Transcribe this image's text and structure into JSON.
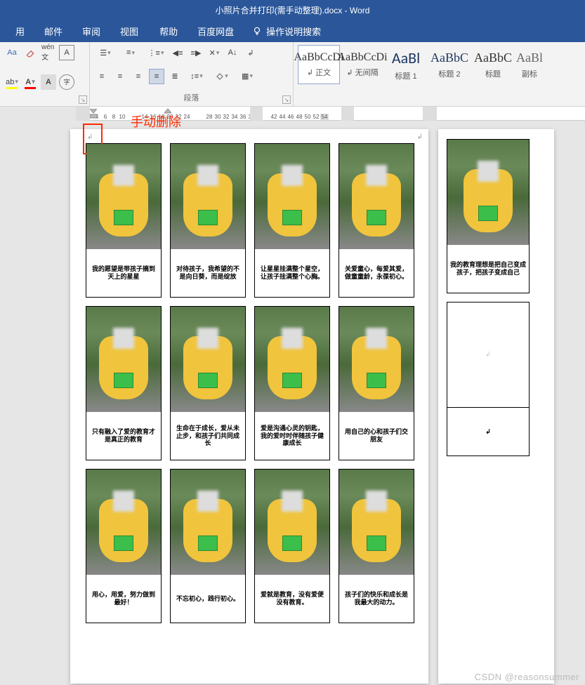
{
  "title_bar": {
    "text": "小照片合并打印(需手动整理).docx - Word"
  },
  "tabs": {
    "t0": "用",
    "t1": "邮件",
    "t2": "审阅",
    "t3": "视图",
    "t4": "帮助",
    "t5": "百度网盘",
    "tell_me": "操作说明搜索"
  },
  "font_group": {
    "label": "",
    "aa": "Aa",
    "wen": "wén文"
  },
  "para_group": {
    "label": "段落"
  },
  "styles": {
    "s0": {
      "preview": "AaBbCcDi",
      "label": "↲ 正文"
    },
    "s1": {
      "preview": "AaBbCcDi",
      "label": "↲ 无间隔"
    },
    "s2": {
      "preview": "AaBl",
      "label": "标题 1"
    },
    "s3": {
      "preview": "AaBbC",
      "label": "标题 2"
    },
    "s4": {
      "preview": "AaBbC",
      "label": "标题"
    },
    "s5": {
      "preview": "AaBl",
      "label": "副标"
    }
  },
  "ruler": {
    "nums": [
      "2",
      "2",
      "4",
      "6",
      "8",
      "10",
      "",
      "14",
      "16",
      "18",
      "20",
      "22",
      "24",
      "",
      "28",
      "30",
      "32",
      "34",
      "36",
      "38",
      "",
      "42",
      "44",
      "46",
      "48",
      "50",
      "52",
      "54"
    ]
  },
  "annotation": {
    "text": "手动删除"
  },
  "captions": {
    "c0": "我的愿望是带孩子摘到天上的星星",
    "c1": "对待孩子，我希望的不是向日葵，而是绽放",
    "c2": "让星星挂满整个星空，让孩子挂满整个心胸。",
    "c3": "关爱童心，每爱其爱，做童童龄，永葆初心。",
    "c4": "我的教育理想是把自己变成孩子，把孩子变成自己",
    "c5": "只有融入了爱的教育才是真正的教育",
    "c6": "生命在于成长，爱从未止步，和孩子们共同成长",
    "c7": "爱是沟通心灵的钥匙，我的爱时时伴随孩子健康成长",
    "c8": "用自己的心和孩子们交朋友",
    "c9": "用心，用爱，努力做到最好！",
    "c10": "不忘初心，践行初心。",
    "c11": "爱就是教育，没有爱便没有教育。",
    "c12": "孩子们的快乐和成长是我最大的动力。"
  },
  "watermark": {
    "text": "CSDN @reasonsummer"
  }
}
